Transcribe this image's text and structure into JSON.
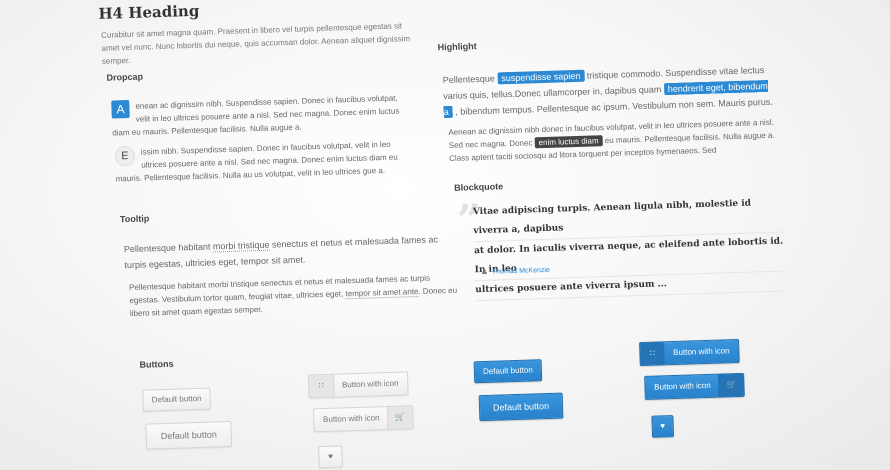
{
  "heading": "H4 Heading",
  "lead": "Curabitur sit amet magna quam. Praesent in libero vel turpis pellentesque egestas sit amet vel nunc. Nunc lobortis dui neque, quis accumsan dolor. Aenean aliquet dignissim semper.",
  "dropcap": {
    "title": "Dropcap",
    "p1_cap": "A",
    "p1_text": "enean ac dignissim nibh. Suspendisse sapien. Donec in faucibus volutpat, velit in leo ultrices posuere ante a nisl. Sed nec magna. Donec enim luctus diam eu mauris. Pellentesque facilisis. Nulla augue a.",
    "p2_cap": "E",
    "p2_text": "issim nibh. Suspendisse sapien. Donec in faucibus volutpat, velit in leo ultrices posuere ante a nisl. Sed nec magna. Donec enim luctus diam eu mauris. Pellentesque facilisis. Nulla au us volutpat, velit in leo ultrices gue a."
  },
  "highlight": {
    "title": "Highlight",
    "t1": "Pellentesque ",
    "h1": "suspendisse sapien",
    "t2": " tristique commodo. Suspendisse vitae lectus varius quis, tellus.Donec ullamcorper in, dapibus quam ",
    "h2": "hendrerit eget, bibendum a",
    "t3": " , bibendum tempus. Pellentesque ac ipsum. Vestibulum non sem. Mauris purus.",
    "s1": "Aenean ac dignissim nibh donec in faucibus volutpat, velit in leo ultrices posuere ante a nisl. Sed nec magna. Donec ",
    "h3": "enim luctus diam",
    "s2": " eu mauris. Pellentesque facilisis. Nulla augue a. Class aptent taciti sociosqu ad litora torquent per inceptos hymenaeos. Sed"
  },
  "tooltip": {
    "title": "Tooltip",
    "l1a": "Pellentesque habitant ",
    "l1tip": "morbi tristique",
    "l1b": " senectus et netus et malesuada fames ac turpis egestas, ultricies eget, tempor sit amet.",
    "s1a": "Pellentesque habitant morbi tristique senectus et netus et malesuada fames ac turpis egestas. Vestibulum tortor quam, feugiat vitae, ultricies eget, ",
    "s1tip": "tempor sit amet ante",
    "s1b": ". Donec eu libero sit amet quam egestas semper."
  },
  "blockquote": {
    "title": "Blockquote",
    "line1": "Vitae adipiscing turpis. Aenean ligula nibh, molestie id viverra a, dapibus",
    "line2": "at dolor. In iaculis viverra neque, ac eleifend ante lobortis id. In in leo",
    "line3": "ultrices posuere ante viverra ipsum ...",
    "author": "Thomas McKenzie"
  },
  "buttons": {
    "title": "Buttons",
    "default_label": "Default button",
    "icon_label": "Button with icon"
  },
  "icons": {
    "grid": "grid-icon",
    "cart": "cart-icon",
    "heart": "heart-icon",
    "person": "person-icon"
  },
  "colors": {
    "accent": "#2c8ad4",
    "dark_highlight": "#444444"
  }
}
